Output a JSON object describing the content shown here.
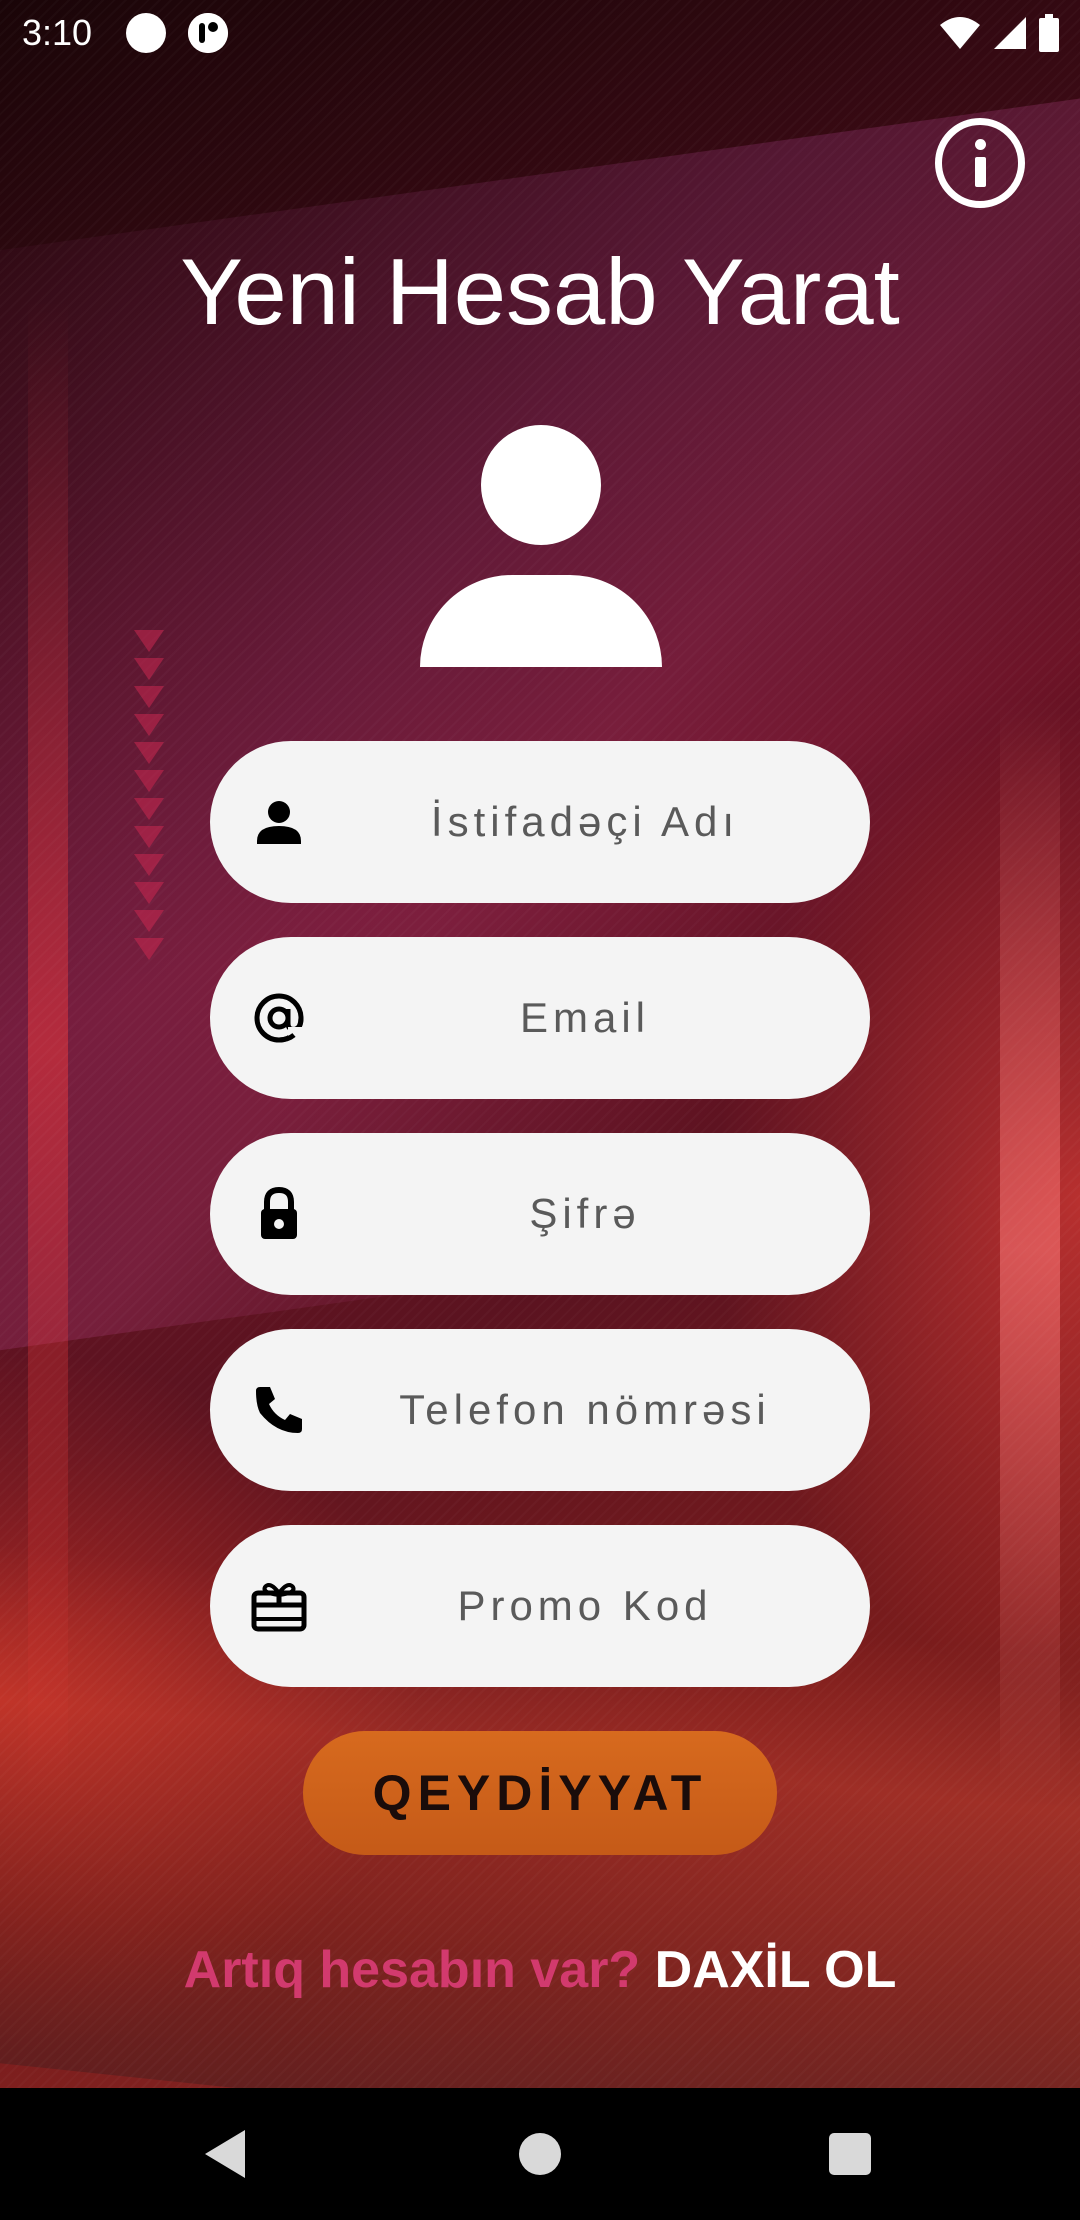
{
  "status_bar": {
    "time": "3:10",
    "icons": [
      "circle-notification-icon",
      "app-notification-icon",
      "wifi-icon",
      "signal-icon",
      "battery-icon"
    ]
  },
  "header": {
    "title": "Yeni Hesab Yarat",
    "info_icon": "info-icon"
  },
  "avatar_icon": "person-avatar-icon",
  "form": {
    "fields": [
      {
        "icon": "person-icon",
        "placeholder": "İstifadəçi Adı"
      },
      {
        "icon": "at-sign-icon",
        "placeholder": "Email"
      },
      {
        "icon": "lock-icon",
        "placeholder": "Şifrə"
      },
      {
        "icon": "phone-icon",
        "placeholder": "Telefon nömrəsi"
      },
      {
        "icon": "gift-card-icon",
        "placeholder": "Promo Kod"
      }
    ],
    "submit_label": "QEYDİYYAT"
  },
  "login": {
    "question": "Artıq hesabın var?",
    "link_label": "DAXİL OL"
  },
  "colors": {
    "field_bg": "#f4f4f4",
    "button_accent": "#d76a1e",
    "question_text": "#d23a6e",
    "background_dark": "#3a0a14"
  },
  "nav_bar": {
    "icons": [
      "back-icon",
      "home-icon",
      "recents-icon"
    ]
  }
}
